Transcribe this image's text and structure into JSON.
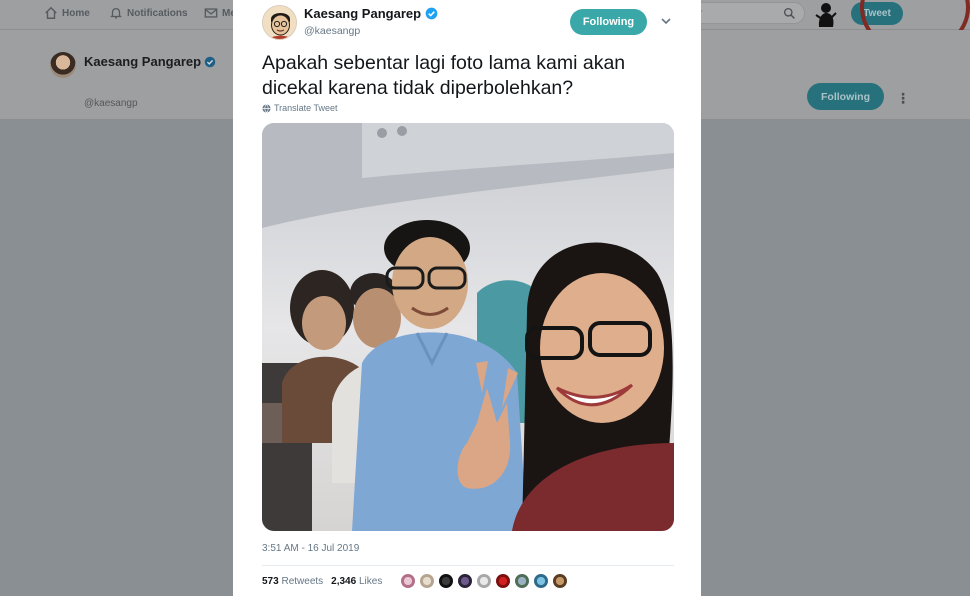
{
  "nav": {
    "home": "Home",
    "notifications": "Notifications",
    "messages": "Me",
    "search_placeholder": "r",
    "tweet_button": "Tweet"
  },
  "background_profile": {
    "name": "Kaesang Pangarep",
    "handle": "@kaesangp",
    "following_button": "Following"
  },
  "tweet": {
    "author_name": "Kaesang Pangarep",
    "author_handle": "@kaesangp",
    "following_button": "Following",
    "text": "Apakah sebentar lagi foto lama kami akan\ndicekal karena tidak diperbolehkan?",
    "translate": "Translate Tweet",
    "timestamp": "3:51 AM - 16 Jul 2019",
    "retweets_count": "573",
    "retweets_label": "Retweets",
    "likes_count": "2,346",
    "likes_label": "Likes"
  },
  "colors": {
    "accent": "#3aa8a8",
    "verified": "#1da1f2",
    "overlay": "#8a8f94"
  },
  "icons": {
    "home": "home-icon",
    "notifications": "bell-icon",
    "messages": "envelope-icon",
    "search": "search-icon",
    "verified": "verified-badge-icon",
    "caret": "chevron-down-icon",
    "translate": "globe-icon"
  }
}
